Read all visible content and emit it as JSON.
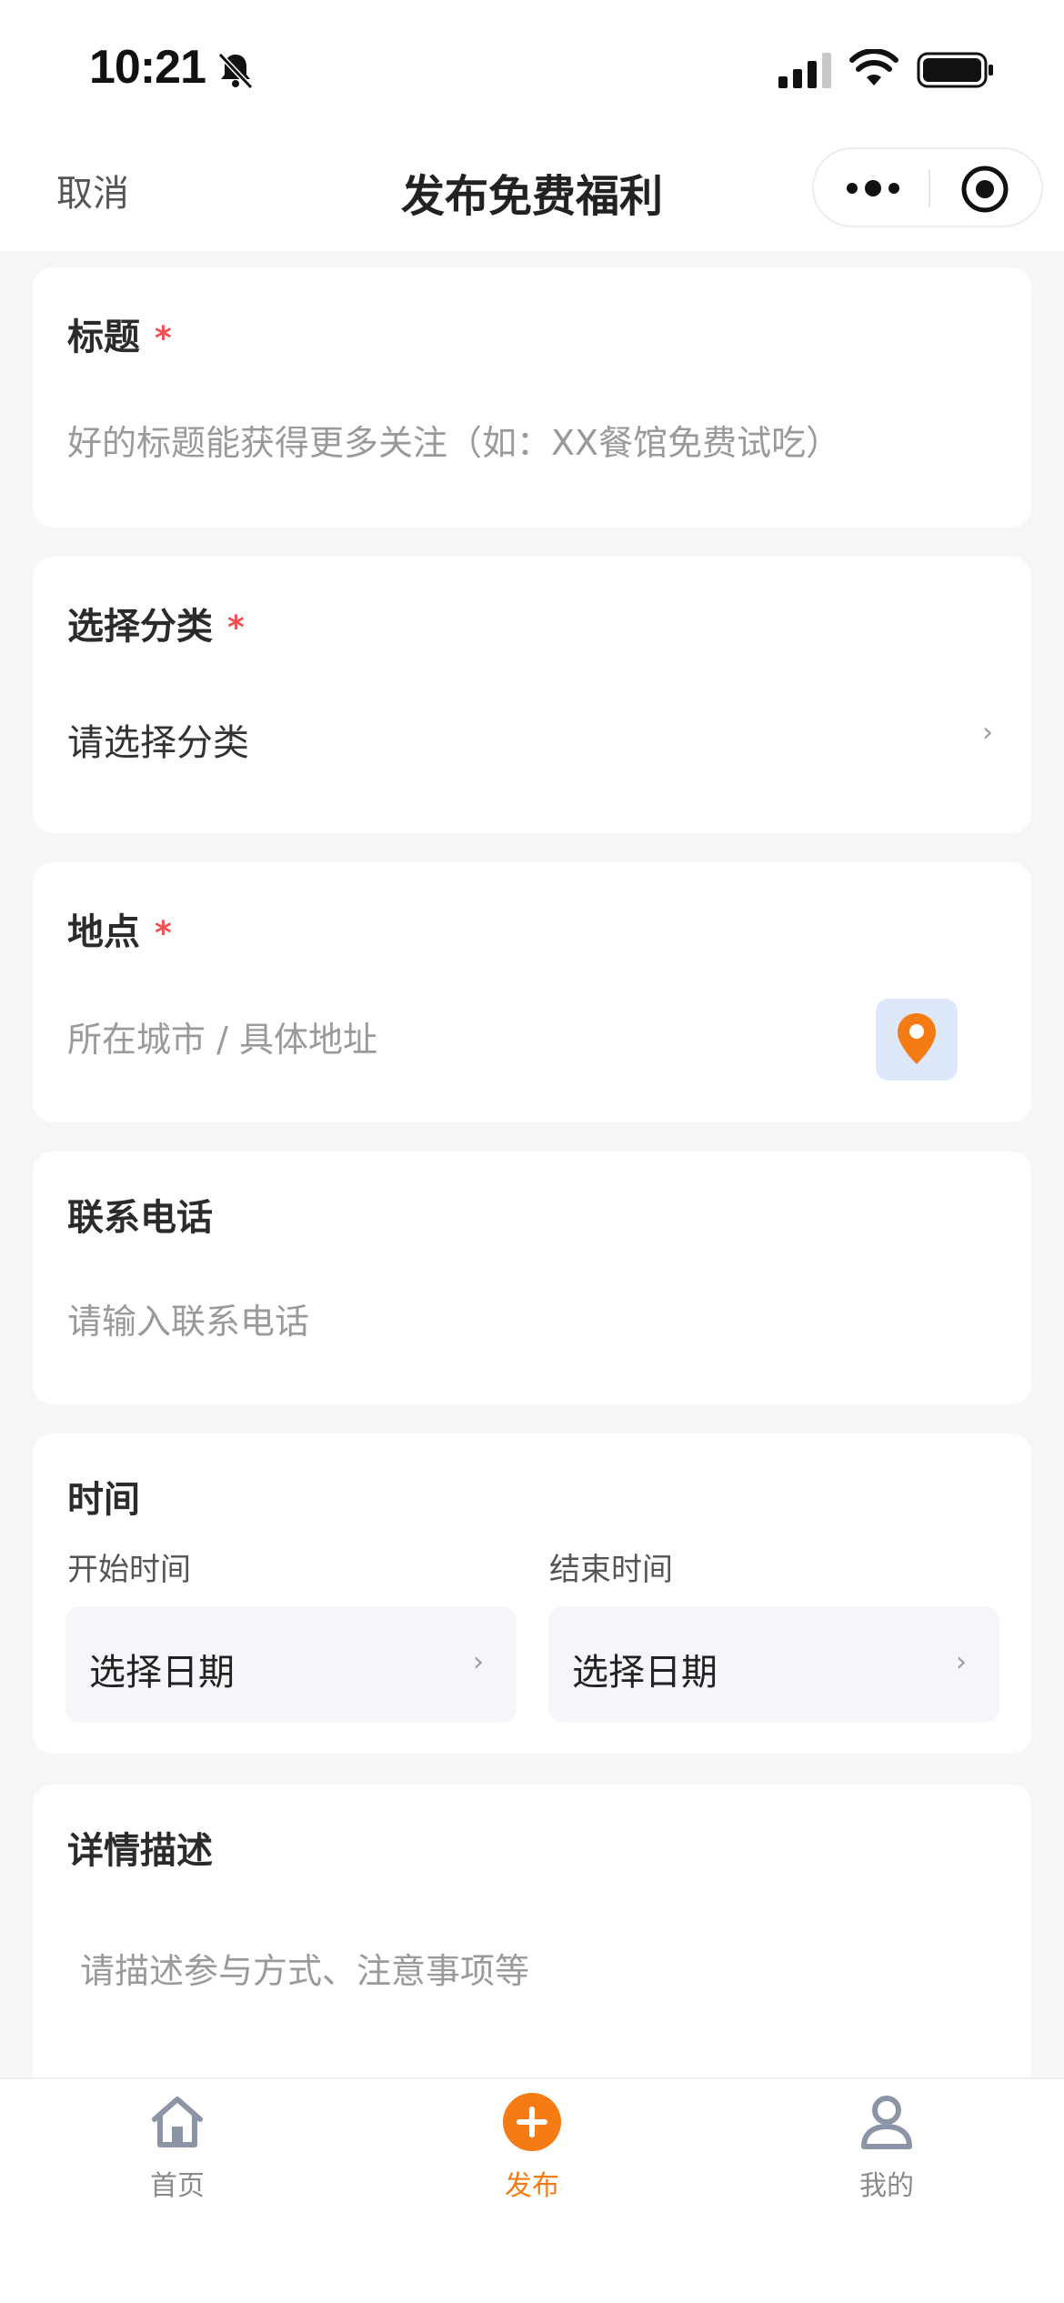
{
  "status_bar": {
    "time": "10:21",
    "icons": [
      "bell-slash-icon",
      "signal-icon",
      "wifi-icon",
      "battery-icon"
    ]
  },
  "nav": {
    "cancel_label": "取消",
    "title": "发布免费福利",
    "icons": [
      "more-icon",
      "target-icon"
    ]
  },
  "form": {
    "title_field": {
      "label": "标题",
      "required_mark": "*",
      "placeholder": "好的标题能获得更多关注（如：XX餐馆免费试吃）"
    },
    "category_field": {
      "label": "选择分类",
      "required_mark": "*",
      "value": "请选择分类",
      "chevron": "›"
    },
    "location_field": {
      "label": "地点",
      "required_mark": "*",
      "placeholder": "所在城市 / 具体地址",
      "icon": "map-pin-icon"
    },
    "phone_field": {
      "label": "联系电话",
      "placeholder": "请输入联系电话"
    },
    "time_field": {
      "label": "时间",
      "start_label": "开始时间",
      "end_label": "结束时间",
      "start_value": "选择日期",
      "end_value": "选择日期",
      "chevron": "›"
    },
    "description_field": {
      "label": "详情描述",
      "placeholder": "请描述参与方式、注意事项等"
    }
  },
  "tab_bar": {
    "items": [
      {
        "label": "首页",
        "icon": "home-icon",
        "active": false
      },
      {
        "label": "发布",
        "icon": "plus-circle-icon",
        "active": true
      },
      {
        "label": "我的",
        "icon": "user-icon",
        "active": false
      }
    ]
  },
  "colors": {
    "accent": "#f57c14",
    "required": "#f05050",
    "background": "#f5f6f8",
    "location_button_bg": "#dde9fb"
  }
}
